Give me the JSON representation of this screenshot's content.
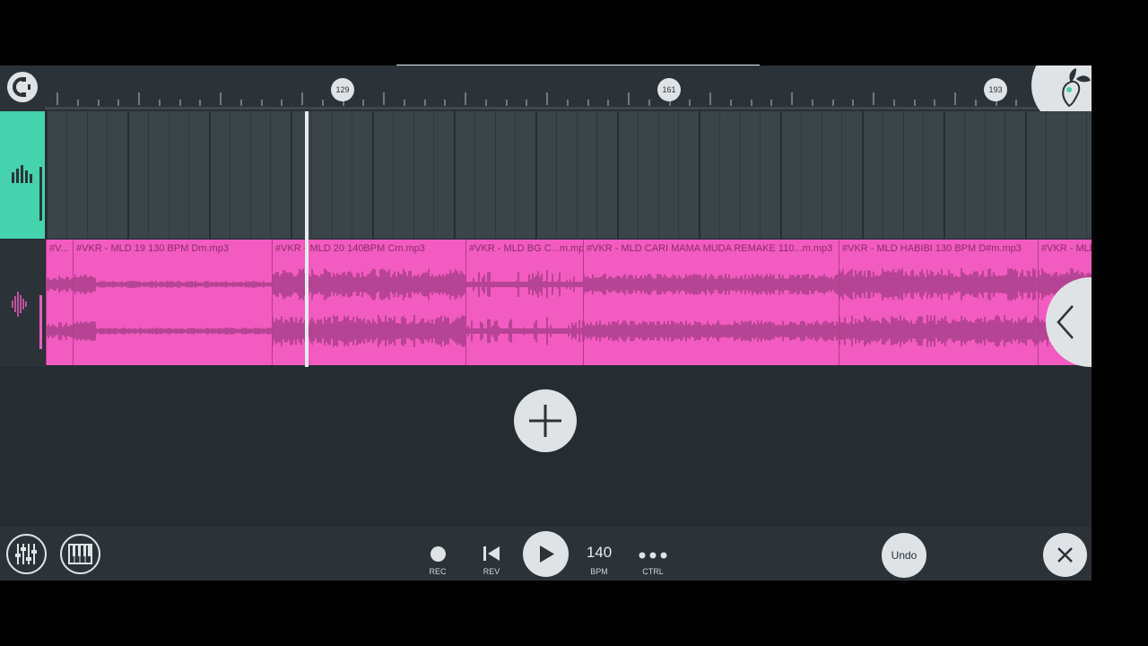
{
  "ruler": {
    "markers": [
      "129",
      "161",
      "193"
    ]
  },
  "clips": [
    {
      "label": "#V..."
    },
    {
      "label": "#VKR - MLD 19 130 BPM Dm.mp3"
    },
    {
      "label": "#VKR - MLD 20 140BPM Cm.mp3"
    },
    {
      "label": "#VKR - MLD BG C...m.mp3"
    },
    {
      "label": "#VKR - MLD CARI MAMA MUDA REMAKE 110...m.mp3"
    },
    {
      "label": "#VKR - MLD HABIBI 130 BPM D#m.mp3"
    },
    {
      "label": "#VKR - MLD"
    }
  ],
  "transport": {
    "rec_label": "REC",
    "rev_label": "REV",
    "bpm_value": "140",
    "bpm_label": "BPM",
    "ctrl_label": "CTRL",
    "undo_label": "Undo"
  },
  "icons": {
    "magnet": "magnet-icon",
    "logo": "fruit-logo-icon",
    "mixer": "mixer-icon",
    "piano": "piano-icon",
    "close": "close-icon",
    "add": "plus-icon",
    "collapse": "chevron-left-icon"
  },
  "colors": {
    "accent_teal": "#45d3ae",
    "clip_pink": "#f25bbf",
    "background": "#252d32"
  }
}
